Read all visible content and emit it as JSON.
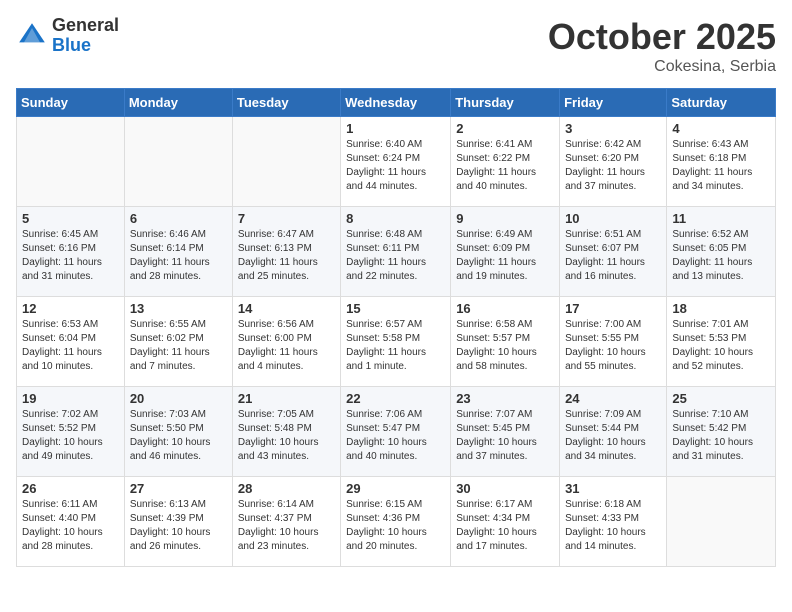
{
  "header": {
    "logo_general": "General",
    "logo_blue": "Blue",
    "month": "October 2025",
    "location": "Cokesina, Serbia"
  },
  "weekdays": [
    "Sunday",
    "Monday",
    "Tuesday",
    "Wednesday",
    "Thursday",
    "Friday",
    "Saturday"
  ],
  "weeks": [
    [
      {
        "day": "",
        "info": ""
      },
      {
        "day": "",
        "info": ""
      },
      {
        "day": "",
        "info": ""
      },
      {
        "day": "1",
        "info": "Sunrise: 6:40 AM\nSunset: 6:24 PM\nDaylight: 11 hours\nand 44 minutes."
      },
      {
        "day": "2",
        "info": "Sunrise: 6:41 AM\nSunset: 6:22 PM\nDaylight: 11 hours\nand 40 minutes."
      },
      {
        "day": "3",
        "info": "Sunrise: 6:42 AM\nSunset: 6:20 PM\nDaylight: 11 hours\nand 37 minutes."
      },
      {
        "day": "4",
        "info": "Sunrise: 6:43 AM\nSunset: 6:18 PM\nDaylight: 11 hours\nand 34 minutes."
      }
    ],
    [
      {
        "day": "5",
        "info": "Sunrise: 6:45 AM\nSunset: 6:16 PM\nDaylight: 11 hours\nand 31 minutes."
      },
      {
        "day": "6",
        "info": "Sunrise: 6:46 AM\nSunset: 6:14 PM\nDaylight: 11 hours\nand 28 minutes."
      },
      {
        "day": "7",
        "info": "Sunrise: 6:47 AM\nSunset: 6:13 PM\nDaylight: 11 hours\nand 25 minutes."
      },
      {
        "day": "8",
        "info": "Sunrise: 6:48 AM\nSunset: 6:11 PM\nDaylight: 11 hours\nand 22 minutes."
      },
      {
        "day": "9",
        "info": "Sunrise: 6:49 AM\nSunset: 6:09 PM\nDaylight: 11 hours\nand 19 minutes."
      },
      {
        "day": "10",
        "info": "Sunrise: 6:51 AM\nSunset: 6:07 PM\nDaylight: 11 hours\nand 16 minutes."
      },
      {
        "day": "11",
        "info": "Sunrise: 6:52 AM\nSunset: 6:05 PM\nDaylight: 11 hours\nand 13 minutes."
      }
    ],
    [
      {
        "day": "12",
        "info": "Sunrise: 6:53 AM\nSunset: 6:04 PM\nDaylight: 11 hours\nand 10 minutes."
      },
      {
        "day": "13",
        "info": "Sunrise: 6:55 AM\nSunset: 6:02 PM\nDaylight: 11 hours\nand 7 minutes."
      },
      {
        "day": "14",
        "info": "Sunrise: 6:56 AM\nSunset: 6:00 PM\nDaylight: 11 hours\nand 4 minutes."
      },
      {
        "day": "15",
        "info": "Sunrise: 6:57 AM\nSunset: 5:58 PM\nDaylight: 11 hours\nand 1 minute."
      },
      {
        "day": "16",
        "info": "Sunrise: 6:58 AM\nSunset: 5:57 PM\nDaylight: 10 hours\nand 58 minutes."
      },
      {
        "day": "17",
        "info": "Sunrise: 7:00 AM\nSunset: 5:55 PM\nDaylight: 10 hours\nand 55 minutes."
      },
      {
        "day": "18",
        "info": "Sunrise: 7:01 AM\nSunset: 5:53 PM\nDaylight: 10 hours\nand 52 minutes."
      }
    ],
    [
      {
        "day": "19",
        "info": "Sunrise: 7:02 AM\nSunset: 5:52 PM\nDaylight: 10 hours\nand 49 minutes."
      },
      {
        "day": "20",
        "info": "Sunrise: 7:03 AM\nSunset: 5:50 PM\nDaylight: 10 hours\nand 46 minutes."
      },
      {
        "day": "21",
        "info": "Sunrise: 7:05 AM\nSunset: 5:48 PM\nDaylight: 10 hours\nand 43 minutes."
      },
      {
        "day": "22",
        "info": "Sunrise: 7:06 AM\nSunset: 5:47 PM\nDaylight: 10 hours\nand 40 minutes."
      },
      {
        "day": "23",
        "info": "Sunrise: 7:07 AM\nSunset: 5:45 PM\nDaylight: 10 hours\nand 37 minutes."
      },
      {
        "day": "24",
        "info": "Sunrise: 7:09 AM\nSunset: 5:44 PM\nDaylight: 10 hours\nand 34 minutes."
      },
      {
        "day": "25",
        "info": "Sunrise: 7:10 AM\nSunset: 5:42 PM\nDaylight: 10 hours\nand 31 minutes."
      }
    ],
    [
      {
        "day": "26",
        "info": "Sunrise: 6:11 AM\nSunset: 4:40 PM\nDaylight: 10 hours\nand 28 minutes."
      },
      {
        "day": "27",
        "info": "Sunrise: 6:13 AM\nSunset: 4:39 PM\nDaylight: 10 hours\nand 26 minutes."
      },
      {
        "day": "28",
        "info": "Sunrise: 6:14 AM\nSunset: 4:37 PM\nDaylight: 10 hours\nand 23 minutes."
      },
      {
        "day": "29",
        "info": "Sunrise: 6:15 AM\nSunset: 4:36 PM\nDaylight: 10 hours\nand 20 minutes."
      },
      {
        "day": "30",
        "info": "Sunrise: 6:17 AM\nSunset: 4:34 PM\nDaylight: 10 hours\nand 17 minutes."
      },
      {
        "day": "31",
        "info": "Sunrise: 6:18 AM\nSunset: 4:33 PM\nDaylight: 10 hours\nand 14 minutes."
      },
      {
        "day": "",
        "info": ""
      }
    ]
  ]
}
